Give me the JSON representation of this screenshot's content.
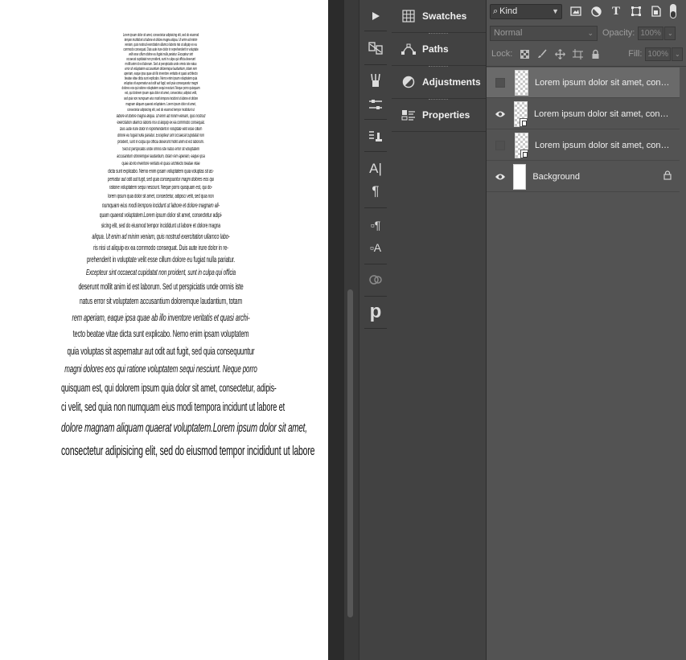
{
  "canvas": {
    "lines": [
      {
        "text": "Lorem ipsum dolor sit amet, consectetur adipisicing elit, sed do eiusmod",
        "size": 5,
        "gap": 1
      },
      {
        "text": "tempor incididunt ut labore et dolore magna aliqua. Ut enim ad minim",
        "size": 5,
        "gap": 1
      },
      {
        "text": "veniam, quis nostrud exercitation ullamco laboris nisi ut aliquip ex ea",
        "size": 5,
        "gap": 1
      },
      {
        "text": "commodo consequat. Duis aute irure dolor in reprehenderit in voluptate",
        "size": 5,
        "gap": 1
      },
      {
        "text": "velit esse cillum dolore eu fugiat nulla pariatur. Excepteur sint",
        "size": 5,
        "gap": 1
      },
      {
        "text": "occaecat cupidatat non proident, sunt in culpa qui officia deserunt",
        "size": 5,
        "gap": 1
      },
      {
        "text": "mollit anim id est laborum. Sed ut perspiciatis unde omnis iste natus",
        "size": 5,
        "gap": 1
      },
      {
        "text": "error sit voluptatem accusantium doloremque laudantium, totam rem",
        "size": 5,
        "gap": 1
      },
      {
        "text": "aperiam, eaque ipsa quae ab illo inventore veritatis et quasi architecto",
        "size": 5,
        "gap": 1
      },
      {
        "text": "beatae vitae dicta sunt explicabo. Nemo enim ipsam voluptatem quia",
        "size": 5,
        "gap": 1
      },
      {
        "text": "voluptas sit aspernatur aut odit aut fugit, sed quia consequuntur magni",
        "size": 5,
        "gap": 1
      },
      {
        "text": "dolores eos qui ratione voluptatem sequi nesciunt. Neque porro quisquam",
        "size": 5,
        "gap": 1
      },
      {
        "text": "est, qui dolorem ipsum quia dolor sit amet, consectetur, adipisci velit,",
        "size": 5,
        "gap": 2
      },
      {
        "text": "sed quia non numquam eius modi tempora incidunt ut labore et dolore",
        "size": 5,
        "gap": 2
      },
      {
        "text": "magnam aliquam quaerat voluptatem. Lorem ipsum dolor sit amet,",
        "size": 5,
        "gap": 2
      },
      {
        "text": "consectetur adipisicing elit, sed do eiusmod tempor incididunt ut",
        "size": 5,
        "gap": 2
      },
      {
        "text": "labore et dolore magna aliqua. Ut enim ad minim veniam, quis nostrud",
        "size": 6,
        "gap": 2
      },
      {
        "text": "exercitation ullamco laboris nisi ut aliquip ex ea commodo consequat.",
        "size": 6,
        "gap": 2
      },
      {
        "text": "Duis aute irure dolor in reprehenderit in voluptate velit esse cillum",
        "size": 6,
        "gap": 2
      },
      {
        "text": "dolore eu fugiat nulla pariatur. Excepteur sint occaecat cupidatat non",
        "size": 6,
        "gap": 2
      },
      {
        "text": "proident, sunt in culpa qui officia deserunt mollit anim id est laborum.",
        "size": 6,
        "gap": 3
      },
      {
        "text": "Sed ut perspiciatis unde omnis iste natus error sit voluptatem",
        "size": 6,
        "gap": 3
      },
      {
        "text": "accusantium doloremque laudantium, totam rem aperiam, eaque ipsa",
        "size": 6,
        "gap": 3
      },
      {
        "text": "quae ab illo inventore veritatis et quasi architecto beatae vitae",
        "size": 6,
        "gap": 3
      },
      {
        "text": "dicta sunt explicabo. Nemo enim ipsam voluptatem quia voluptas sit as-",
        "size": 7,
        "gap": 3
      },
      {
        "text": "pernatur aut odit aut fugit, sed quia consequuntur magni dolores eos qui",
        "size": 7,
        "gap": 3
      },
      {
        "text": "ratione voluptatem sequi nesciunt. Neque porro quisquam est, qui do-",
        "size": 7,
        "gap": 4
      },
      {
        "text": "lorem ipsum quia dolor sit amet, consectetur, adipisci velit, sed quia non",
        "size": 7,
        "gap": 4
      },
      {
        "text": "numquam eius modi tempora incidunt ut labore et dolore magnam ali-",
        "size": 8,
        "gap": 4
      },
      {
        "text": "quam quaerat voluptatem.Lorem ipsum dolor sit amet, consectetur adipi-",
        "size": 8,
        "gap": 5
      },
      {
        "text": "sicing elit, sed do eiusmod tempor incididunt ut labore et dolore magna",
        "size": 8,
        "gap": 5
      },
      {
        "text": "aliqua. Ut enim ad minim veniam, quis nostrud exercitation ullamco labo-",
        "size": 9,
        "gap": 5
      },
      {
        "text": "ris nisi ut aliquip ex ea commodo consequat. Duis aute irure dolor in re-",
        "size": 9,
        "gap": 6
      },
      {
        "text": "prehenderit in voluptate velit esse cillum dolore eu fugiat nulla pariatur.",
        "size": 10,
        "gap": 6
      },
      {
        "text": "Excepteur sint occaecat cupidatat non proident, sunt in culpa qui officia",
        "size": 10,
        "gap": 7
      },
      {
        "text": "deserunt mollit anim id est laborum. Sed ut perspiciatis unde omnis iste",
        "size": 11,
        "gap": 7
      },
      {
        "text": "natus error sit voluptatem accusantium doloremque laudantium, totam",
        "size": 11,
        "gap": 8
      },
      {
        "text": "rem aperiam, eaque ipsa quae ab illo inventore veritatis et quasi archi-",
        "size": 12,
        "gap": 8
      },
      {
        "text": "tecto beatae vitae dicta sunt explicabo. Nemo enim ipsam voluptatem",
        "size": 12,
        "gap": 9
      },
      {
        "text": "quia voluptas sit aspernatur aut odit aut fugit, sed quia consequuntur",
        "size": 13,
        "gap": 9
      },
      {
        "text": "magni dolores eos qui ratione voluptatem sequi nesciunt. Neque porro",
        "size": 13,
        "gap": 10
      },
      {
        "text": "quisquam est, qui dolorem ipsum quia dolor sit amet, consectetur, adipis-",
        "size": 14,
        "gap": 10
      },
      {
        "text": "ci velit, sed quia non numquam eius modi tempora incidunt ut labore et",
        "size": 15,
        "gap": 11
      },
      {
        "text": "dolore magnam aliquam quaerat voluptatem.Lorem ipsum dolor sit amet,",
        "size": 16,
        "gap": 11
      },
      {
        "text": "consectetur adipisicing elit, sed do eiusmod tempor incididunt ut labore",
        "size": 17,
        "gap": 0
      }
    ]
  },
  "panels": {
    "items": [
      {
        "label": "Swatches",
        "icon": "grid-icon"
      },
      {
        "label": "Paths",
        "icon": "pen-path-icon"
      },
      {
        "label": "Adjustments",
        "icon": "half-circle-icon"
      },
      {
        "label": "Properties",
        "icon": "properties-icon"
      }
    ]
  },
  "layers": {
    "filter": {
      "kind_label": "Kind"
    },
    "blend": {
      "mode": "Normal",
      "opacity_label": "Opacity:",
      "opacity_value": "100%"
    },
    "lock": {
      "label": "Lock:",
      "fill_label": "Fill:",
      "fill_value": "100%"
    },
    "items": [
      {
        "name": "Lorem ipsum dolor sit amet, consectetur adipisicing",
        "visible": false,
        "selected": true,
        "type": "smart"
      },
      {
        "name": "Lorem ipsum dolor sit amet, consectetur adipisicing",
        "visible": true,
        "selected": false,
        "type": "smart"
      },
      {
        "name": "Lorem ipsum dolor sit amet, consectetur adipisicing",
        "visible": false,
        "selected": false,
        "type": "smart"
      },
      {
        "name": "Background",
        "visible": true,
        "selected": false,
        "type": "background"
      }
    ]
  },
  "colors": {
    "panel_bg": "#535353",
    "panel_dark": "#424242",
    "selected_row": "#6a6a6a",
    "canvas": "#ffffff"
  }
}
